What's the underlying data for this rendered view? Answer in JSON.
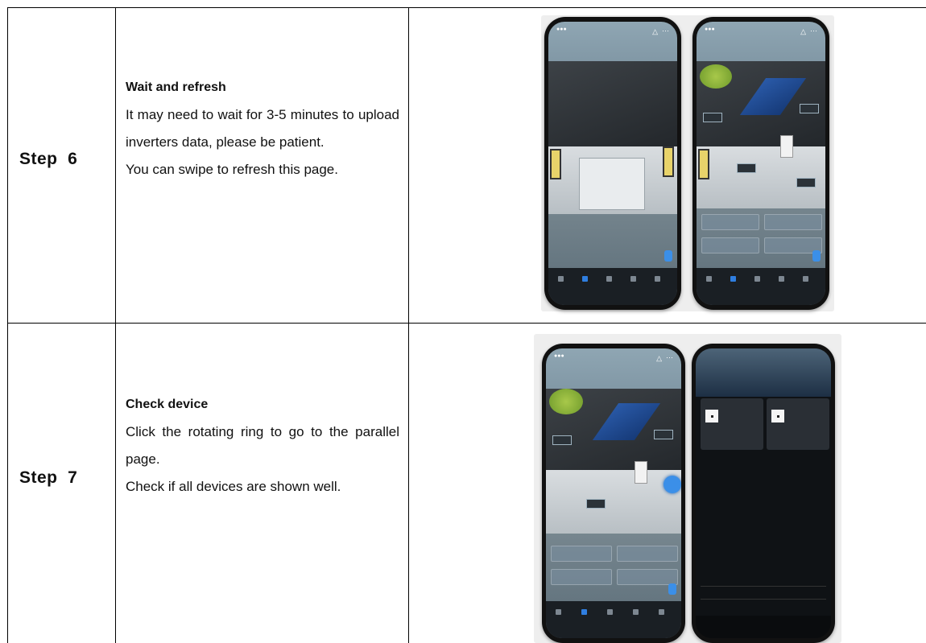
{
  "rows": [
    {
      "step": "Step  6",
      "title": "Wait and refresh",
      "lines": [
        "It may need to wait for 3-5 minutes to upload inverters data, please be patient.",
        "You can swipe to refresh this page."
      ]
    },
    {
      "step": "Step  7",
      "title": "Check device",
      "lines": [
        "Click the rotating ring to go to the parallel page.",
        "Check if all devices are shown well."
      ]
    }
  ],
  "colors": {
    "accent": "#3b8fe8",
    "border": "#000000"
  }
}
